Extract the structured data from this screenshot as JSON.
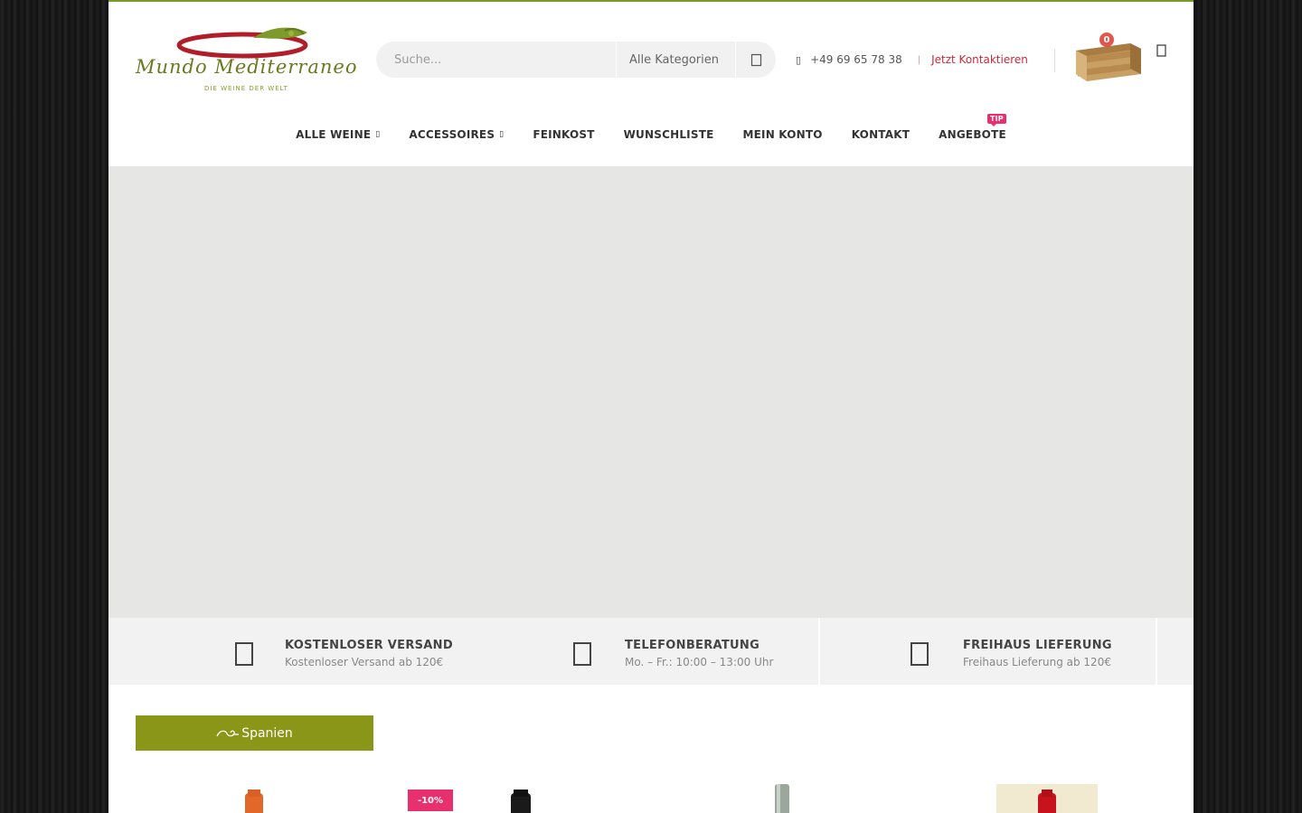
{
  "logo": {
    "name": "Mundo Mediterraneo",
    "tagline": "DIE WEINE DER WELT"
  },
  "search": {
    "placeholder": "Suche...",
    "category": "Alle Kategorien",
    "button_icon": "search-icon"
  },
  "contact": {
    "phone_icon": "phone-icon",
    "phone": "+49 69 65 78 38",
    "separator": "|",
    "link": "Jetzt Kontaktieren"
  },
  "cart": {
    "count": "0",
    "icon": "wine-crate-icon"
  },
  "nav": {
    "items": [
      {
        "label": "ALLE WEINE",
        "has_dropdown": true
      },
      {
        "label": "ACCESSOIRES",
        "has_dropdown": true
      },
      {
        "label": "FEINKOST",
        "has_dropdown": false
      },
      {
        "label": "WUNSCHLISTE",
        "has_dropdown": false
      },
      {
        "label": "MEIN KONTO",
        "has_dropdown": false
      },
      {
        "label": "KONTAKT",
        "has_dropdown": false
      },
      {
        "label": "ANGEBOTE",
        "has_dropdown": false,
        "badge": "TIP"
      }
    ]
  },
  "features": [
    {
      "title": "KOSTENLOSER VERSAND",
      "subtitle": "Kostenloser Versand ab 120€",
      "icon": "truck-icon"
    },
    {
      "title": "TELEFONBERATUNG",
      "subtitle": "Mo. – Fr.: 10:00 – 13:00 Uhr",
      "icon": "phone-icon"
    },
    {
      "title": "FREIHAUS LIEFERUNG",
      "subtitle": "Freihaus Lieferung ab 120€",
      "icon": "home-delivery-icon"
    }
  ],
  "section": {
    "tab_label": "Spanien"
  },
  "products": [
    {
      "discount": ""
    },
    {
      "discount": "-10%"
    },
    {
      "discount": ""
    },
    {
      "discount": ""
    }
  ],
  "colors": {
    "accent_green": "#8a9617",
    "brand_red": "#c8283a",
    "badge_pink": "#e8306e",
    "cart_badge": "#e0564f",
    "top_border": "#7a9a2c"
  }
}
